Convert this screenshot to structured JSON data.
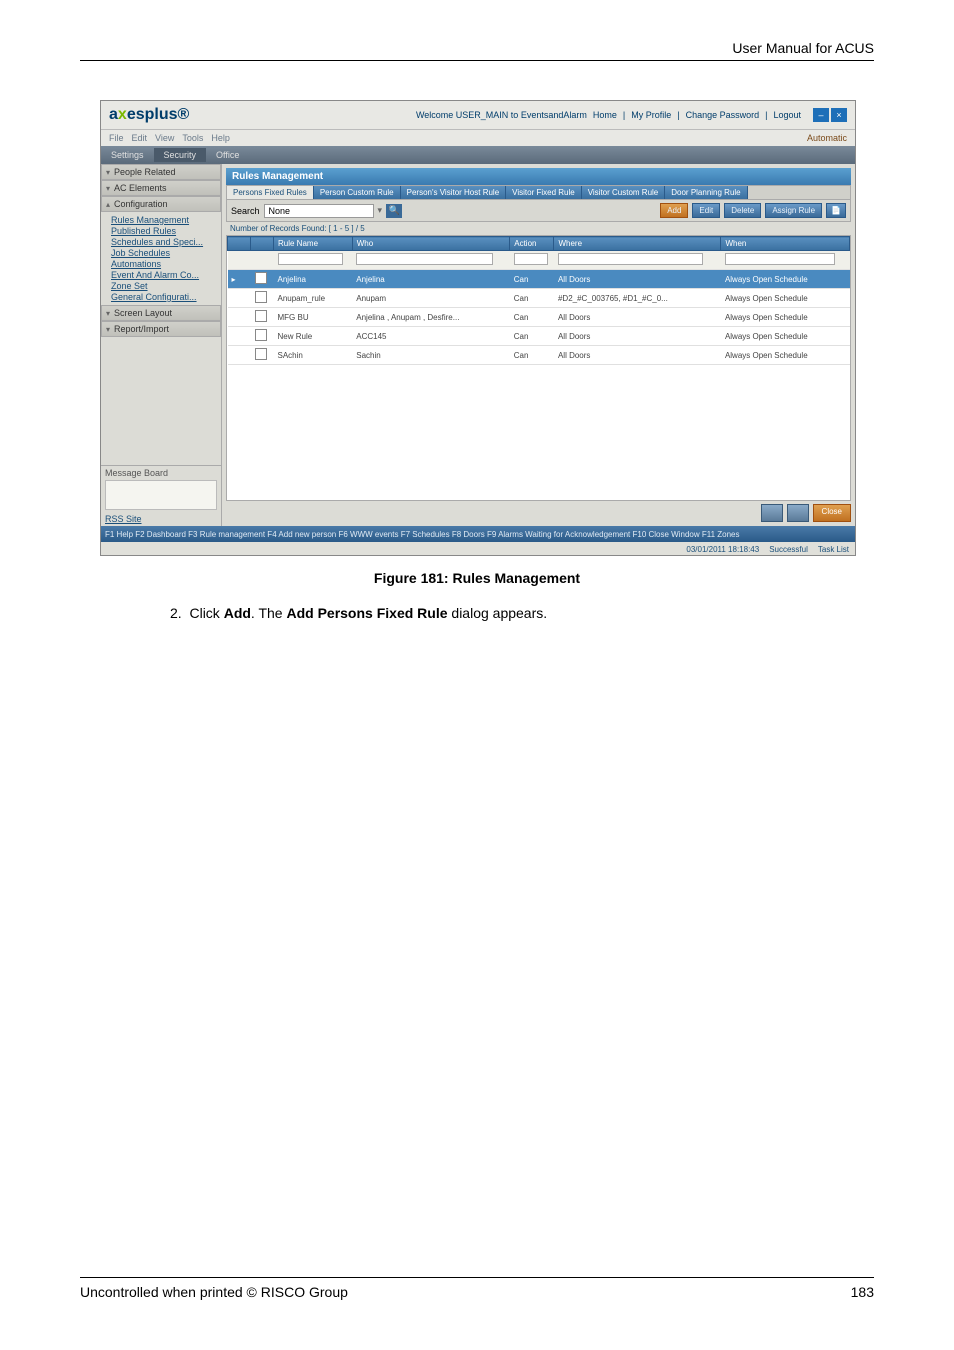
{
  "document": {
    "header_right": "User Manual for ACUS",
    "caption": "Figure 181: Rules Management",
    "step_num": "2.",
    "step_pre": "Click",
    "step_b1": "Add",
    "step_mid": ". The",
    "step_b2": "Add Persons Fixed Rule",
    "step_post": "dialog appears.",
    "footer_left": "Uncontrolled when printed © RISCO Group",
    "page_number": "183"
  },
  "app": {
    "logo_a": "a",
    "logo_b": "x",
    "logo_c": "esplus®",
    "welcome": "Welcome USER_MAIN to EventsandAlarm",
    "links": {
      "home": "Home",
      "profile": "My Profile",
      "changepw": "Change Password",
      "logout": "Logout"
    },
    "menu": [
      "File",
      "Edit",
      "View",
      "Tools",
      "Help"
    ],
    "automatic": "Automatic",
    "ribbon": [
      "Settings",
      "Security",
      "Office"
    ],
    "fkeys": "F1 Help   F2 Dashboard   F3 Rule management   F4 Add new person   F6 WWW events   F7 Schedules   F8 Doors   F9 Alarms Waiting for Acknowledgement   F10 Close Window   F11 Zones",
    "status": {
      "time": "03/01/2011 18:18:43",
      "successful": "Successful",
      "tasklist": "Task List"
    }
  },
  "sidebar": {
    "sections": [
      "People Related",
      "AC Elements",
      "Configuration",
      "Screen Layout",
      "Report/Import"
    ],
    "config_links": [
      "Rules Management",
      "Published Rules",
      "Schedules and Speci...",
      "Job Schedules",
      "Automations",
      "Event And Alarm Co...",
      "Zone Set",
      "General Configurati..."
    ],
    "message_board": "Message Board",
    "rss": "RSS Site"
  },
  "main": {
    "title": "Rules Management",
    "tabs": [
      "Persons Fixed Rules",
      "Person Custom Rule",
      "Person's Visitor Host Rule",
      "Visitor Fixed Rule",
      "Visitor Custom Rule",
      "Door Planning Rule"
    ],
    "search_label": "Search",
    "search_value": "None",
    "buttons": {
      "add": "Add",
      "edit": "Edit",
      "delete": "Delete",
      "assign": "Assign Rule"
    },
    "record_count": "Number of Records Found: [ 1 - 5 ] / 5",
    "columns": [
      "Rule Name",
      "Who",
      "Action",
      "Where",
      "When"
    ],
    "rows": [
      {
        "name": "Anjelina",
        "who": "Anjelina",
        "action": "Can",
        "where": "All Doors",
        "when": "Always Open Schedule"
      },
      {
        "name": "Anupam_rule",
        "who": "Anupam",
        "action": "Can",
        "where": "#D2_#C_003765, #D1_#C_0...",
        "when": "Always Open Schedule"
      },
      {
        "name": "MFG BU",
        "who": "Anjelina , Anupam , Desfire...",
        "action": "Can",
        "where": "All Doors",
        "when": "Always Open Schedule"
      },
      {
        "name": "New Rule",
        "who": "ACC145",
        "action": "Can",
        "where": "All Doors",
        "when": "Always Open Schedule"
      },
      {
        "name": "SAchin",
        "who": "Sachin",
        "action": "Can",
        "where": "All Doors",
        "when": "Always Open Schedule"
      }
    ],
    "close": "Close"
  }
}
